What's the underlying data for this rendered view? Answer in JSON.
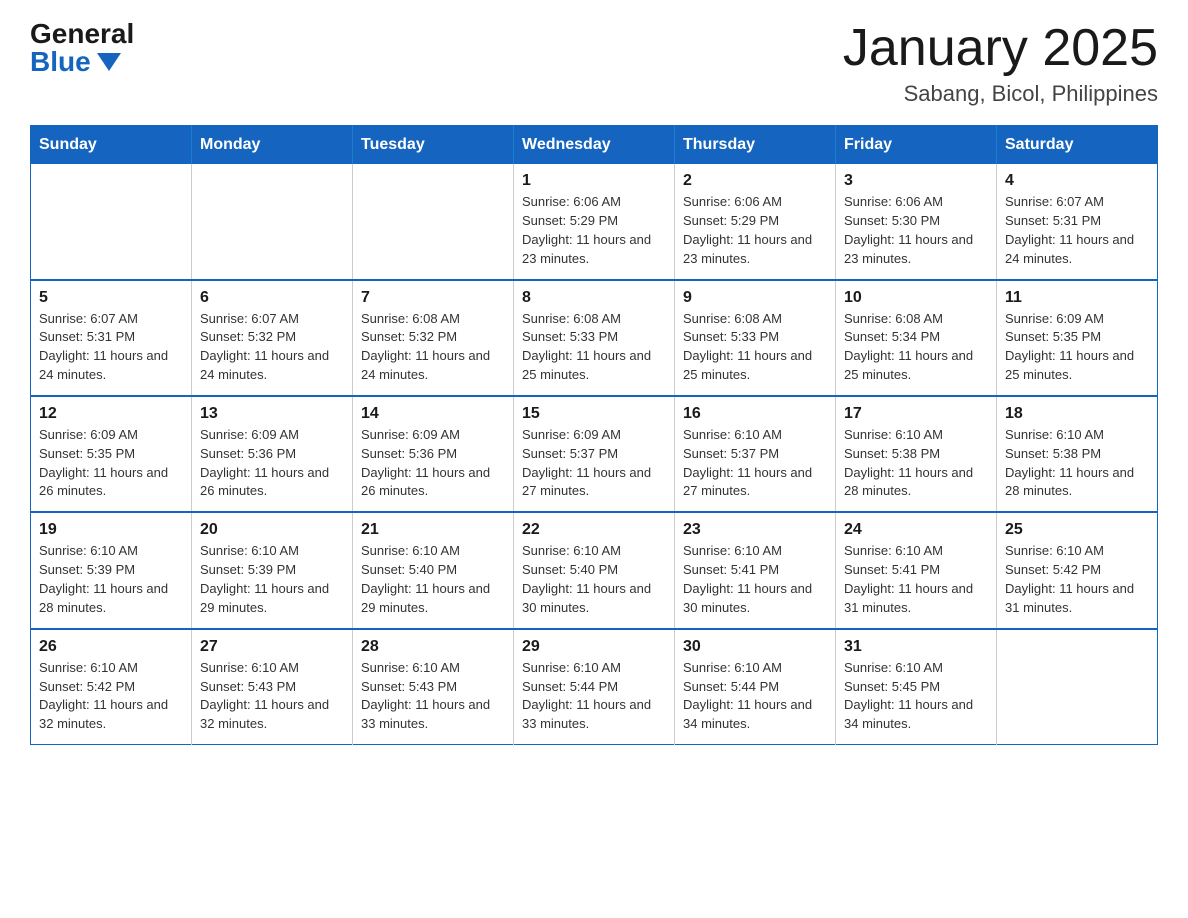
{
  "header": {
    "logo_general": "General",
    "logo_blue": "Blue",
    "month_title": "January 2025",
    "location": "Sabang, Bicol, Philippines"
  },
  "calendar": {
    "days_of_week": [
      "Sunday",
      "Monday",
      "Tuesday",
      "Wednesday",
      "Thursday",
      "Friday",
      "Saturday"
    ],
    "weeks": [
      [
        {
          "day": "",
          "info": ""
        },
        {
          "day": "",
          "info": ""
        },
        {
          "day": "",
          "info": ""
        },
        {
          "day": "1",
          "info": "Sunrise: 6:06 AM\nSunset: 5:29 PM\nDaylight: 11 hours and 23 minutes."
        },
        {
          "day": "2",
          "info": "Sunrise: 6:06 AM\nSunset: 5:29 PM\nDaylight: 11 hours and 23 minutes."
        },
        {
          "day": "3",
          "info": "Sunrise: 6:06 AM\nSunset: 5:30 PM\nDaylight: 11 hours and 23 minutes."
        },
        {
          "day": "4",
          "info": "Sunrise: 6:07 AM\nSunset: 5:31 PM\nDaylight: 11 hours and 24 minutes."
        }
      ],
      [
        {
          "day": "5",
          "info": "Sunrise: 6:07 AM\nSunset: 5:31 PM\nDaylight: 11 hours and 24 minutes."
        },
        {
          "day": "6",
          "info": "Sunrise: 6:07 AM\nSunset: 5:32 PM\nDaylight: 11 hours and 24 minutes."
        },
        {
          "day": "7",
          "info": "Sunrise: 6:08 AM\nSunset: 5:32 PM\nDaylight: 11 hours and 24 minutes."
        },
        {
          "day": "8",
          "info": "Sunrise: 6:08 AM\nSunset: 5:33 PM\nDaylight: 11 hours and 25 minutes."
        },
        {
          "day": "9",
          "info": "Sunrise: 6:08 AM\nSunset: 5:33 PM\nDaylight: 11 hours and 25 minutes."
        },
        {
          "day": "10",
          "info": "Sunrise: 6:08 AM\nSunset: 5:34 PM\nDaylight: 11 hours and 25 minutes."
        },
        {
          "day": "11",
          "info": "Sunrise: 6:09 AM\nSunset: 5:35 PM\nDaylight: 11 hours and 25 minutes."
        }
      ],
      [
        {
          "day": "12",
          "info": "Sunrise: 6:09 AM\nSunset: 5:35 PM\nDaylight: 11 hours and 26 minutes."
        },
        {
          "day": "13",
          "info": "Sunrise: 6:09 AM\nSunset: 5:36 PM\nDaylight: 11 hours and 26 minutes."
        },
        {
          "day": "14",
          "info": "Sunrise: 6:09 AM\nSunset: 5:36 PM\nDaylight: 11 hours and 26 minutes."
        },
        {
          "day": "15",
          "info": "Sunrise: 6:09 AM\nSunset: 5:37 PM\nDaylight: 11 hours and 27 minutes."
        },
        {
          "day": "16",
          "info": "Sunrise: 6:10 AM\nSunset: 5:37 PM\nDaylight: 11 hours and 27 minutes."
        },
        {
          "day": "17",
          "info": "Sunrise: 6:10 AM\nSunset: 5:38 PM\nDaylight: 11 hours and 28 minutes."
        },
        {
          "day": "18",
          "info": "Sunrise: 6:10 AM\nSunset: 5:38 PM\nDaylight: 11 hours and 28 minutes."
        }
      ],
      [
        {
          "day": "19",
          "info": "Sunrise: 6:10 AM\nSunset: 5:39 PM\nDaylight: 11 hours and 28 minutes."
        },
        {
          "day": "20",
          "info": "Sunrise: 6:10 AM\nSunset: 5:39 PM\nDaylight: 11 hours and 29 minutes."
        },
        {
          "day": "21",
          "info": "Sunrise: 6:10 AM\nSunset: 5:40 PM\nDaylight: 11 hours and 29 minutes."
        },
        {
          "day": "22",
          "info": "Sunrise: 6:10 AM\nSunset: 5:40 PM\nDaylight: 11 hours and 30 minutes."
        },
        {
          "day": "23",
          "info": "Sunrise: 6:10 AM\nSunset: 5:41 PM\nDaylight: 11 hours and 30 minutes."
        },
        {
          "day": "24",
          "info": "Sunrise: 6:10 AM\nSunset: 5:41 PM\nDaylight: 11 hours and 31 minutes."
        },
        {
          "day": "25",
          "info": "Sunrise: 6:10 AM\nSunset: 5:42 PM\nDaylight: 11 hours and 31 minutes."
        }
      ],
      [
        {
          "day": "26",
          "info": "Sunrise: 6:10 AM\nSunset: 5:42 PM\nDaylight: 11 hours and 32 minutes."
        },
        {
          "day": "27",
          "info": "Sunrise: 6:10 AM\nSunset: 5:43 PM\nDaylight: 11 hours and 32 minutes."
        },
        {
          "day": "28",
          "info": "Sunrise: 6:10 AM\nSunset: 5:43 PM\nDaylight: 11 hours and 33 minutes."
        },
        {
          "day": "29",
          "info": "Sunrise: 6:10 AM\nSunset: 5:44 PM\nDaylight: 11 hours and 33 minutes."
        },
        {
          "day": "30",
          "info": "Sunrise: 6:10 AM\nSunset: 5:44 PM\nDaylight: 11 hours and 34 minutes."
        },
        {
          "day": "31",
          "info": "Sunrise: 6:10 AM\nSunset: 5:45 PM\nDaylight: 11 hours and 34 minutes."
        },
        {
          "day": "",
          "info": ""
        }
      ]
    ]
  }
}
